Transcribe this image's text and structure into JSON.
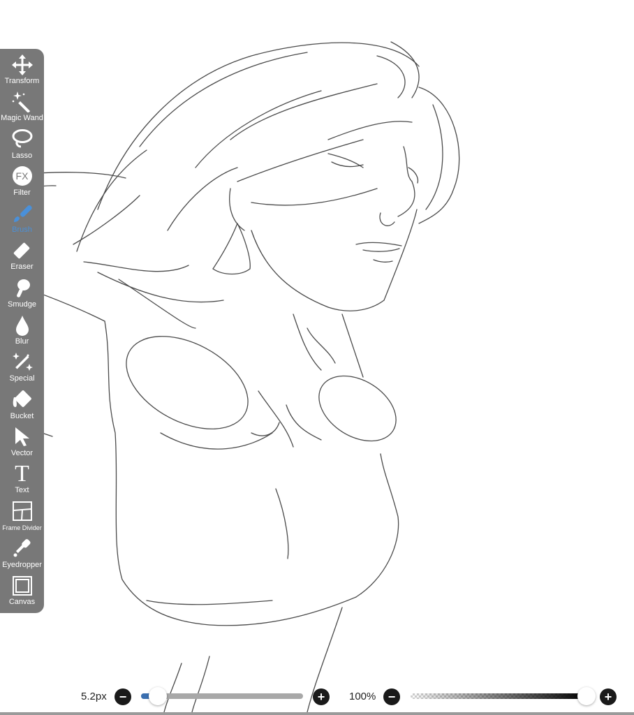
{
  "toolbar": {
    "active_color": "#4a90d9",
    "items": [
      {
        "label": "Transform",
        "icon": "transform-icon"
      },
      {
        "label": "Magic Wand",
        "icon": "magic-wand-icon"
      },
      {
        "label": "Lasso",
        "icon": "lasso-icon"
      },
      {
        "label": "Filter",
        "icon": "fx-icon",
        "icon_text": "FX"
      },
      {
        "label": "Brush",
        "icon": "brush-icon",
        "active": true
      },
      {
        "label": "Eraser",
        "icon": "eraser-icon"
      },
      {
        "label": "Smudge",
        "icon": "smudge-icon"
      },
      {
        "label": "Blur",
        "icon": "blur-drop-icon"
      },
      {
        "label": "Special",
        "icon": "special-sparkle-icon"
      },
      {
        "label": "Bucket",
        "icon": "bucket-icon"
      },
      {
        "label": "Vector",
        "icon": "vector-arrow-icon"
      },
      {
        "label": "Text",
        "icon": "text-icon",
        "icon_text": "T"
      },
      {
        "label": "Frame Divider",
        "icon": "frame-divider-icon"
      },
      {
        "label": "Eyedropper",
        "icon": "eyedropper-icon"
      },
      {
        "label": "Canvas",
        "icon": "canvas-icon"
      }
    ]
  },
  "bottom_bar": {
    "brush_size": {
      "label": "5.2px",
      "level": 0.1
    },
    "opacity": {
      "label": "100%",
      "level": 1.0
    },
    "minus_symbol": "−",
    "plus_symbol": "+"
  }
}
